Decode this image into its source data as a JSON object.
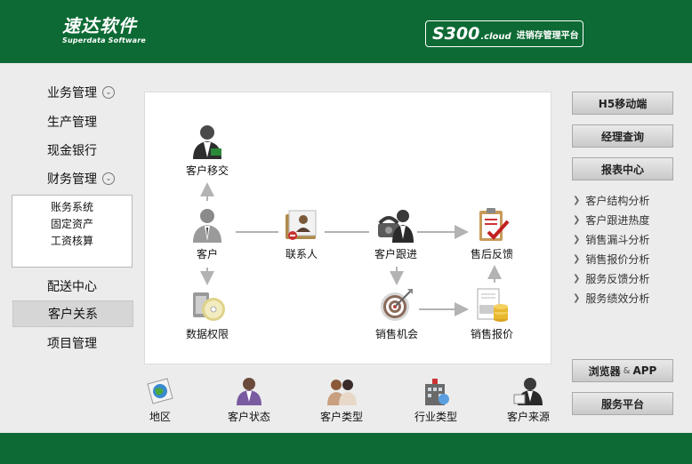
{
  "header": {
    "logo_cn": "速达软件",
    "logo_en": "Superdata Software",
    "product_main": "S300",
    "product_suffix": ".cloud",
    "product_platform": "进销存管理平台"
  },
  "sidebar": {
    "items": [
      {
        "label": "业务管理",
        "expandable": true
      },
      {
        "label": "生产管理"
      },
      {
        "label": "现金银行"
      },
      {
        "label": "财务管理",
        "expandable": true
      },
      {
        "label": "配送中心"
      },
      {
        "label": "客户关系",
        "active": true
      },
      {
        "label": "项目管理"
      }
    ],
    "finance_sub": [
      "账务系统",
      "固定资产",
      "工资核算"
    ]
  },
  "flow": {
    "customer_transfer": "客户移交",
    "customer": "客户",
    "contact": "联系人",
    "customer_followup": "客户跟进",
    "after_sales": "售后反馈",
    "data_permission": "数据权限",
    "sales_opportunity": "销售机会",
    "sales_quote": "销售报价"
  },
  "bottom": [
    "地区",
    "客户状态",
    "客户类型",
    "行业类型",
    "客户来源"
  ],
  "right": {
    "h5": "H5移动端",
    "manager_query": "经理查询",
    "report_center": "报表中心",
    "reports": [
      "客户结构分析",
      "客户跟进热度",
      "销售漏斗分析",
      "销售报价分析",
      "服务反馈分析",
      "服务绩效分析"
    ],
    "browser_main": "浏览器",
    "browser_amp": "&",
    "browser_app": "APP",
    "service_platform": "服务平台"
  },
  "colors": {
    "brand_green": "#0d6a34",
    "background": "#ececec",
    "active_nav": "#d6d6d6",
    "arrow": "#b3b3b3"
  },
  "icons": {
    "person": "person-icon",
    "folder": "folder-icon",
    "phone": "phone-icon",
    "clipboard": "clipboard-icon",
    "cd": "cd-icon",
    "target": "target-icon",
    "coins": "coins-icon"
  }
}
